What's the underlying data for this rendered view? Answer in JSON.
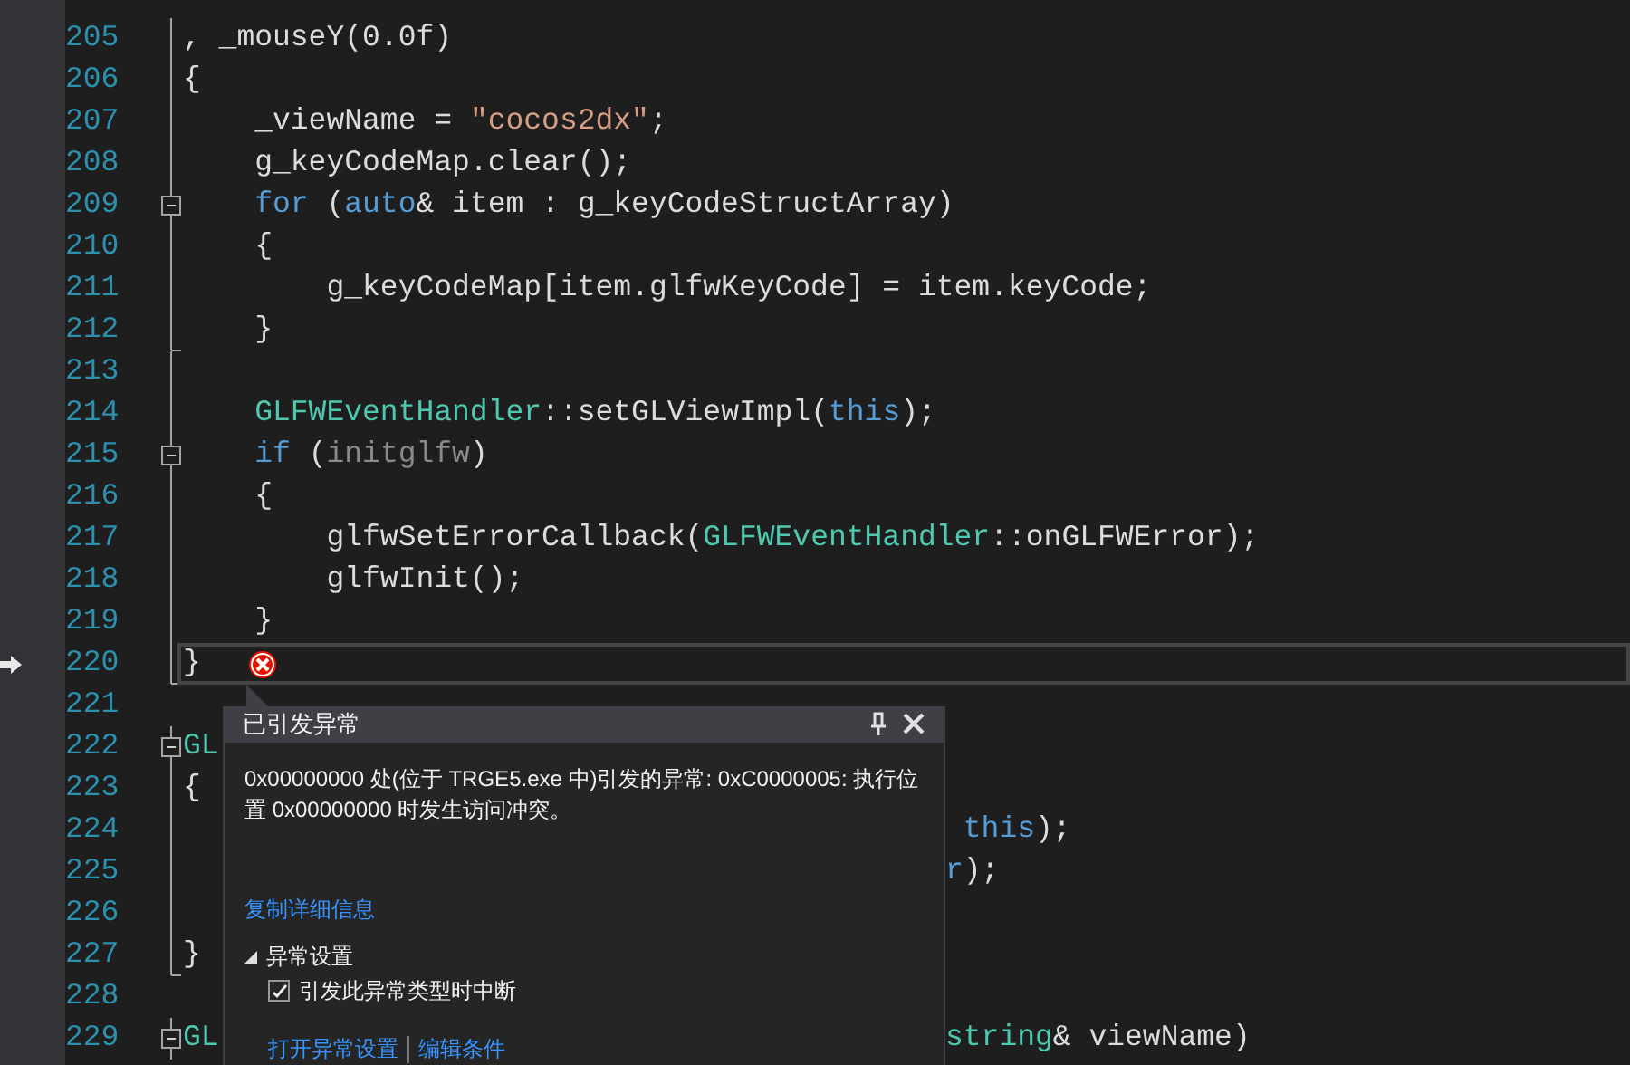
{
  "editor": {
    "lines": [
      {
        "number": "205",
        "fold_box": false,
        "fold_guide": true,
        "fold_end": false,
        "tokens": [
          {
            "kind": "plain",
            "text": ", _mouseY(0.0f)"
          }
        ]
      },
      {
        "number": "206",
        "fold_box": false,
        "fold_guide": true,
        "fold_end": false,
        "tokens": [
          {
            "kind": "plain",
            "text": "{"
          }
        ]
      },
      {
        "number": "207",
        "fold_box": false,
        "fold_guide": true,
        "fold_end": false,
        "tokens": [
          {
            "kind": "plain",
            "text": "    _viewName = "
          },
          {
            "kind": "string",
            "text": "\"cocos2dx\""
          },
          {
            "kind": "plain",
            "text": ";"
          }
        ]
      },
      {
        "number": "208",
        "fold_box": false,
        "fold_guide": true,
        "fold_end": false,
        "tokens": [
          {
            "kind": "plain",
            "text": "    g_keyCodeMap.clear();"
          }
        ]
      },
      {
        "number": "209",
        "fold_box": true,
        "fold_guide": true,
        "fold_end": false,
        "tokens": [
          {
            "kind": "keyword",
            "text": "    for"
          },
          {
            "kind": "plain",
            "text": " ("
          },
          {
            "kind": "keyword",
            "text": "auto"
          },
          {
            "kind": "plain",
            "text": "& item : g_keyCodeStructArray)"
          }
        ]
      },
      {
        "number": "210",
        "fold_box": false,
        "fold_guide": true,
        "fold_end": false,
        "tokens": [
          {
            "kind": "plain",
            "text": "    {"
          }
        ]
      },
      {
        "number": "211",
        "fold_box": false,
        "fold_guide": true,
        "fold_end": false,
        "tokens": [
          {
            "kind": "plain",
            "text": "        g_keyCodeMap[item.glfwKeyCode] = item.keyCode;"
          }
        ]
      },
      {
        "number": "212",
        "fold_box": false,
        "fold_guide": true,
        "fold_end": true,
        "tokens": [
          {
            "kind": "plain",
            "text": "    }"
          }
        ]
      },
      {
        "number": "213",
        "fold_box": false,
        "fold_guide": true,
        "fold_end": false
      },
      {
        "number": "214",
        "fold_box": false,
        "fold_guide": true,
        "fold_end": false,
        "tokens": [
          {
            "kind": "type",
            "text": "    GLFWEventHandler"
          },
          {
            "kind": "plain",
            "text": "::setGLViewImpl("
          },
          {
            "kind": "keyword",
            "text": "this"
          },
          {
            "kind": "plain",
            "text": ");"
          }
        ]
      },
      {
        "number": "215",
        "fold_box": true,
        "fold_guide": true,
        "fold_end": false,
        "tokens": [
          {
            "kind": "keyword",
            "text": "    if"
          },
          {
            "kind": "plain",
            "text": " ("
          },
          {
            "kind": "dim",
            "text": "initglfw"
          },
          {
            "kind": "plain",
            "text": ")"
          }
        ]
      },
      {
        "number": "216",
        "fold_box": false,
        "fold_guide": true,
        "fold_end": false,
        "tokens": [
          {
            "kind": "plain",
            "text": "    {"
          }
        ]
      },
      {
        "number": "217",
        "fold_box": false,
        "fold_guide": true,
        "fold_end": false,
        "tokens": [
          {
            "kind": "plain",
            "text": "        glfwSetErrorCallback("
          },
          {
            "kind": "type",
            "text": "GLFWEventHandler"
          },
          {
            "kind": "plain",
            "text": "::onGLFWError);"
          }
        ]
      },
      {
        "number": "218",
        "fold_box": false,
        "fold_guide": true,
        "fold_end": false,
        "tokens": [
          {
            "kind": "plain",
            "text": "        glfwInit();"
          }
        ]
      },
      {
        "number": "219",
        "fold_box": false,
        "fold_guide": true,
        "fold_end": false,
        "tokens": [
          {
            "kind": "plain",
            "text": "    }"
          }
        ]
      },
      {
        "number": "220",
        "fold_box": false,
        "fold_guide": true,
        "fold_end": true,
        "current": true,
        "error": true,
        "tokens": [
          {
            "kind": "plain",
            "text": "}"
          }
        ]
      },
      {
        "number": "221",
        "fold_box": false,
        "fold_guide": false,
        "fold_end": false
      },
      {
        "number": "222",
        "fold_box": true,
        "fold_guide": true,
        "fold_end": false,
        "tokens": [
          {
            "kind": "type",
            "text": "GL"
          }
        ]
      },
      {
        "number": "223",
        "fold_box": false,
        "fold_guide": true,
        "fold_end": false,
        "tokens": [
          {
            "kind": "plain",
            "text": "{"
          }
        ]
      },
      {
        "number": "224",
        "fold_box": false,
        "fold_guide": true,
        "fold_end": false,
        "right": [
          {
            "kind": "keyword",
            "text": " this"
          },
          {
            "kind": "plain",
            "text": ");"
          }
        ]
      },
      {
        "number": "225",
        "fold_box": false,
        "fold_guide": true,
        "fold_end": false,
        "right": [
          {
            "kind": "keyword",
            "text": "r"
          },
          {
            "kind": "plain",
            "text": ");"
          }
        ]
      },
      {
        "number": "226",
        "fold_box": false,
        "fold_guide": true,
        "fold_end": false
      },
      {
        "number": "227",
        "fold_box": false,
        "fold_guide": true,
        "fold_end": true,
        "tokens": [
          {
            "kind": "plain",
            "text": "}"
          }
        ]
      },
      {
        "number": "228",
        "fold_box": false,
        "fold_guide": false,
        "fold_end": false
      },
      {
        "number": "229",
        "fold_box": true,
        "fold_guide": true,
        "fold_end": false,
        "tokens": [
          {
            "kind": "type",
            "text": "GL"
          }
        ],
        "right": [
          {
            "kind": "type",
            "text": "string"
          },
          {
            "kind": "plain",
            "text": "& viewName)"
          }
        ]
      }
    ]
  },
  "exception_popup": {
    "title": "已引发异常",
    "message": "0x00000000 处(位于 TRGE5.exe 中)引发的异常: 0xC0000005: 执行位置 0x00000000 时发生访问冲突。",
    "copy_link": "复制详细信息",
    "settings": {
      "label": "异常设置",
      "expanded": true,
      "checkbox": {
        "label": "引发此异常类型时中断",
        "checked": true
      }
    },
    "links": [
      "打开异常设置",
      "编辑条件"
    ]
  }
}
